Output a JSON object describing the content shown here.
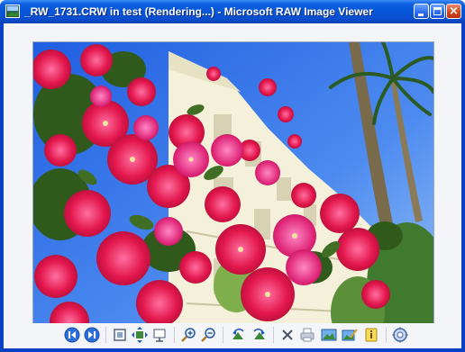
{
  "window": {
    "title": "_RW_1731.CRW in test (Rendering...) - Microsoft RAW Image Viewer",
    "controls": {
      "minimize": "",
      "maximize": "",
      "close": "×"
    }
  },
  "colors": {
    "titlebar": "#0756d8",
    "frame": "#0a3fc6",
    "client_bg": "#f3f5f9",
    "close_button": "#d3431b"
  },
  "image": {
    "subject": "bougainvillea-flowers-palm-trees"
  },
  "toolbar": {
    "buttons": [
      {
        "name": "previous-button",
        "icon": "previous-icon"
      },
      {
        "name": "next-button",
        "icon": "next-icon"
      },
      {
        "name": "actual-size-button",
        "icon": "actual-size-icon"
      },
      {
        "name": "fit-to-window-button",
        "icon": "fit-window-icon"
      },
      {
        "name": "slideshow-button",
        "icon": "slideshow-icon"
      },
      {
        "name": "zoom-in-button",
        "icon": "zoom-in-icon"
      },
      {
        "name": "zoom-out-button",
        "icon": "zoom-out-icon"
      },
      {
        "name": "rotate-left-button",
        "icon": "rotate-left-icon"
      },
      {
        "name": "rotate-right-button",
        "icon": "rotate-right-icon"
      },
      {
        "name": "delete-button",
        "icon": "delete-icon"
      },
      {
        "name": "print-button",
        "icon": "print-icon"
      },
      {
        "name": "copy-to-button",
        "icon": "copy-to-icon"
      },
      {
        "name": "edit-button",
        "icon": "edit-icon"
      },
      {
        "name": "info-button",
        "icon": "info-icon"
      },
      {
        "name": "help-button",
        "icon": "help-icon"
      }
    ]
  }
}
